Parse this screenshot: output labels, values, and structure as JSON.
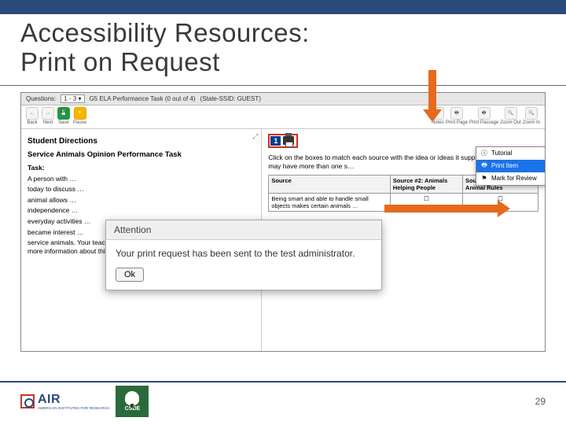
{
  "slide": {
    "title_line1": "Accessibility Resources:",
    "title_line2": "Print on Request",
    "page_number": "29"
  },
  "logos": {
    "air_name": "AIR",
    "air_tag": "AMERICAN INSTITUTES FOR RESEARCH",
    "csde_name": "CSDE"
  },
  "qbar": {
    "label": "Questions:",
    "range": "1 - 3 ▾",
    "task_name": "G5 ELA Performance Task (0 out of 4)",
    "state": "(State-SSID: GUEST)"
  },
  "toolbar": {
    "back": "Back",
    "next": "Next",
    "save": "Save",
    "pause": "Pause",
    "notes": "Notes",
    "print_page": "Print Page",
    "print_pass": "Print Passage",
    "zoom_out": "Zoom Out",
    "zoom_in": "Zoom In"
  },
  "left": {
    "h1": "Student Directions",
    "h2": "Service Animals Opinion Performance Task",
    "task_label": "Task:",
    "para1": "A person with …",
    "para2": "today to discuss …",
    "para3": "animal allows …",
    "para4": "independence …",
    "para5": "everyday activities …",
    "para6": "became interest …",
    "para7": "service animals. Your teacher took your class to the school library to look up more information about this topic. You have found"
  },
  "right": {
    "qnum": "1",
    "instr": "Click on the boxes to match each source with the idea or ideas it supports. Some ideas may have more than one s…",
    "col_source": "Source",
    "col_s2": "Source #2: Animals Helping People",
    "col_s3": "Source #3: New Service Animal Rules",
    "row1": "Being smart and able to handle small objects makes certain animals …"
  },
  "ctx": {
    "tutorial": "Tutorial",
    "print_item": "Print Item",
    "mark_review": "Mark for Review"
  },
  "dialog": {
    "title": "Attention",
    "body": "Your print request has been sent to the test administrator.",
    "ok": "Ok"
  }
}
